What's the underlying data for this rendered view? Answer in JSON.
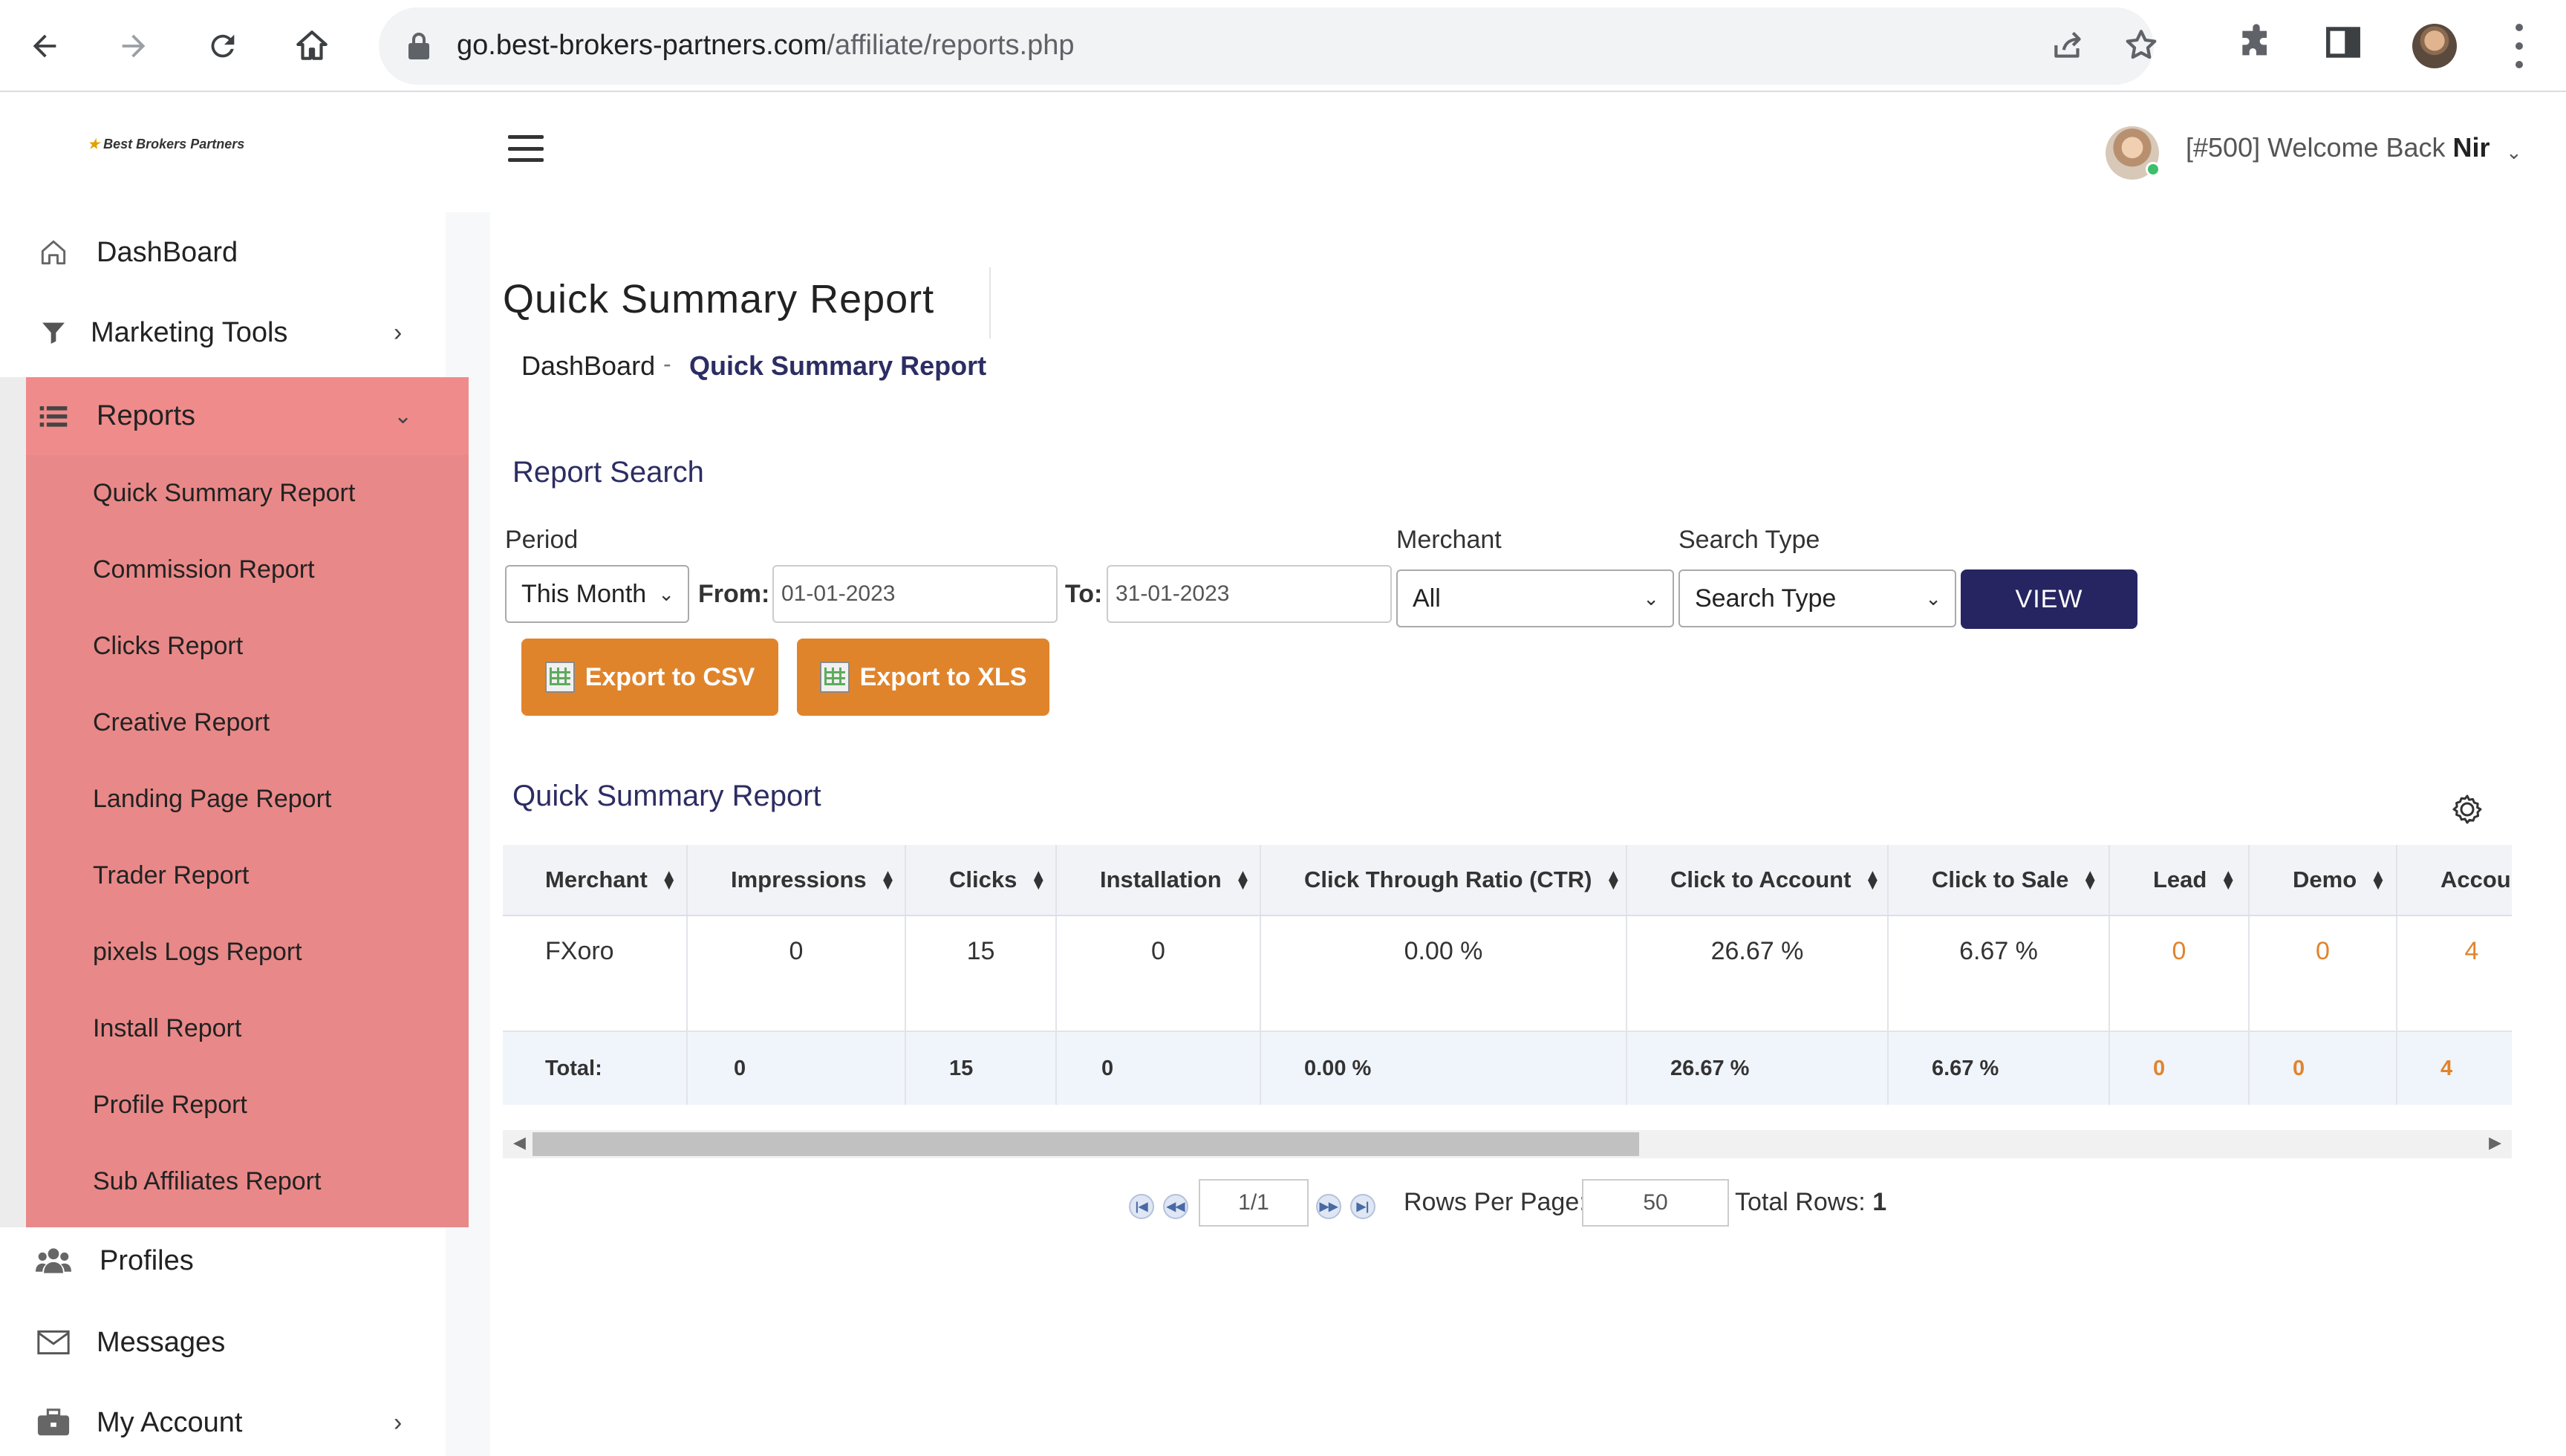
{
  "browser": {
    "url_domain": "go.best-brokers-partners.com",
    "url_path": "/affiliate/reports.php"
  },
  "header": {
    "logo_text": "Best Brokers Partners",
    "welcome_prefix": "[#500] Welcome Back",
    "welcome_name": "Nir"
  },
  "sidebar": {
    "items": [
      {
        "label": "DashBoard",
        "icon": "home-icon"
      },
      {
        "label": "Marketing Tools",
        "icon": "filter-icon"
      },
      {
        "label": "Reports",
        "icon": "list-icon"
      },
      {
        "label": "Profiles",
        "icon": "users-icon"
      },
      {
        "label": "Messages",
        "icon": "envelope-icon"
      },
      {
        "label": "My Account",
        "icon": "briefcase-icon"
      }
    ],
    "report_items": [
      "Quick Summary Report",
      "Commission Report",
      "Clicks Report",
      "Creative Report",
      "Landing Page Report",
      "Trader Report",
      "pixels Logs Report",
      "Install Report",
      "Profile Report",
      "Sub Affiliates Report"
    ]
  },
  "page": {
    "title": "Quick Summary Report",
    "breadcrumb_home": "DashBoard",
    "breadcrumb_sep": "-",
    "breadcrumb_current": "Quick Summary Report"
  },
  "search": {
    "section_title": "Report Search",
    "period_label": "Period",
    "period_value": "This Month",
    "from_label": "From:",
    "from_value": "01-01-2023",
    "to_label": "To:",
    "to_value": "31-01-2023",
    "merchant_label": "Merchant",
    "merchant_value": "All",
    "search_type_label": "Search Type",
    "search_type_value": "Search Type",
    "view_button": "VIEW",
    "export_csv": "Export to CSV",
    "export_xls": "Export to XLS"
  },
  "report": {
    "section_title": "Quick Summary Report",
    "columns": [
      "Merchant",
      "Impressions",
      "Clicks",
      "Installation",
      "Click Through Ratio (CTR)",
      "Click to Account",
      "Click to Sale",
      "Lead",
      "Demo",
      "Accou"
    ],
    "row": [
      "FXoro",
      "0",
      "15",
      "0",
      "0.00 %",
      "26.67 %",
      "6.67 %",
      "0",
      "0",
      "4"
    ],
    "total": [
      "Total:",
      "0",
      "15",
      "0",
      "0.00 %",
      "26.67 %",
      "6.67 %",
      "0",
      "0",
      "4"
    ]
  },
  "pager": {
    "page_value": "1/1",
    "rows_per_page_label": "Rows Per Page:",
    "rows_per_page_value": "50",
    "total_rows_label": "Total Rows:",
    "total_rows_value": "1"
  },
  "colors": {
    "brand_navy": "#262562",
    "export_orange": "#e0842c",
    "sidebar_highlight": "#e98888"
  }
}
